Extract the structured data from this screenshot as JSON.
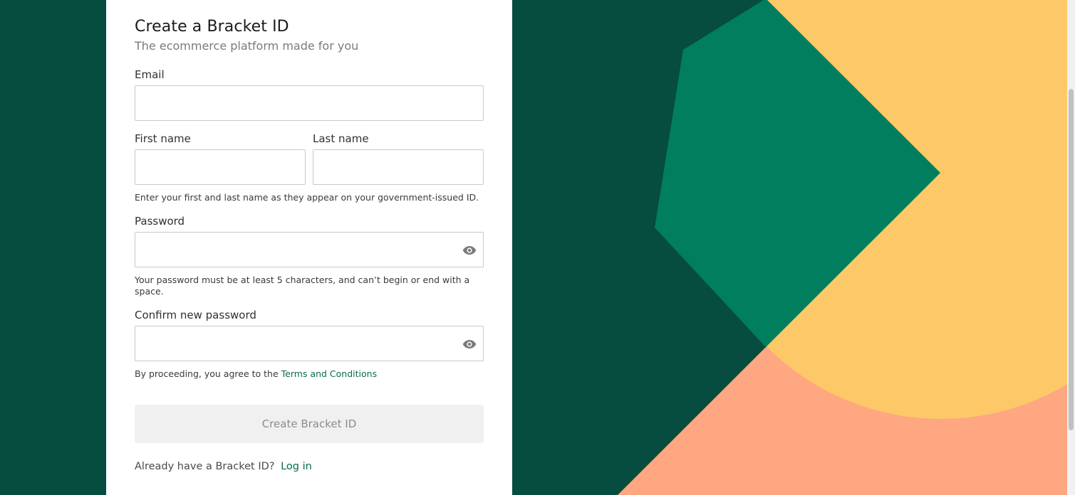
{
  "header": {
    "title": "Create a Bracket ID",
    "subtitle": "The ecommerce platform made for you"
  },
  "form": {
    "email_label": "Email",
    "email_value": "",
    "first_name_label": "First name",
    "first_name_value": "",
    "last_name_label": "Last name",
    "last_name_value": "",
    "name_help": "Enter your first and last name as they appear on your government-issued ID.",
    "password_label": "Password",
    "password_value": "",
    "password_help": "Your password must be at least 5 characters, and can’t begin or end with a space.",
    "confirm_password_label": "Confirm new password",
    "confirm_password_value": "",
    "terms_prefix": "By proceeding, you agree to the",
    "terms_link": "Terms and Conditions",
    "submit_label": "Create Bracket ID",
    "login_prompt": "Already have a Bracket ID?",
    "login_link": "Log in"
  },
  "icons": {
    "password_toggle": "eye-icon",
    "confirm_password_toggle": "eye-icon"
  },
  "colors": {
    "dark_green": "#064c3f",
    "medium_green": "#007e5e",
    "yellow": "#fdc968",
    "salmon": "#fea780",
    "link_green": "#0b6b4f",
    "button_disabled_bg": "#f0f0f0",
    "button_disabled_text": "#8c8c8c"
  }
}
